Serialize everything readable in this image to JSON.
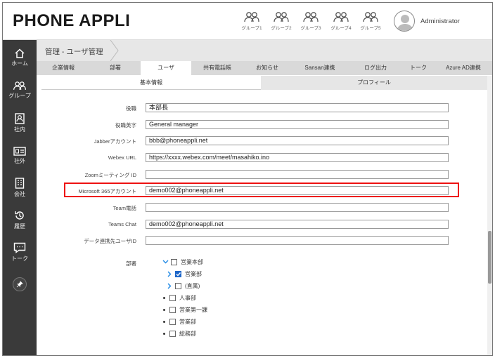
{
  "header": {
    "logo": "PHONE APPLI",
    "groups": [
      "グループ1",
      "グループ2",
      "グループ3",
      "グループ4",
      "グループ5"
    ],
    "user_name": "Administrator"
  },
  "sidebar": {
    "items": [
      {
        "label": "ホーム",
        "icon": "home-icon"
      },
      {
        "label": "グループ",
        "icon": "people-icon"
      },
      {
        "label": "社内",
        "icon": "contact-card-icon"
      },
      {
        "label": "社外",
        "icon": "id-card-icon"
      },
      {
        "label": "会社",
        "icon": "building-icon"
      },
      {
        "label": "履歴",
        "icon": "history-icon"
      },
      {
        "label": "トーク",
        "icon": "chat-icon"
      }
    ],
    "pin_icon": "pin-icon"
  },
  "breadcrumb": "管理 - ユーザ管理",
  "tabs": [
    "企業情報",
    "部署",
    "ユーザ",
    "共有電話帳",
    "お知らせ",
    "Sansan連携",
    "ログ出力",
    "トーク",
    "Azure AD連携"
  ],
  "active_tab": "ユーザ",
  "subtabs": [
    "基本情報",
    "プロフィール"
  ],
  "form": {
    "fields": [
      {
        "label": "役職",
        "value": "本部長"
      },
      {
        "label": "役職英字",
        "value": "General manager"
      },
      {
        "label": "Jabberアカウント",
        "value": "bbb@phoneappli.net"
      },
      {
        "label": "Webex URL",
        "value": "https://xxxx.webex.com/meet/masahiko.ino"
      },
      {
        "label": "Zoomミーティング ID",
        "value": ""
      },
      {
        "label": "Microsoft 365アカウント",
        "value": "demo002@phoneappli.net"
      },
      {
        "label": "Team電話",
        "value": ""
      },
      {
        "label": "Teams Chat",
        "value": "demo002@phoneappli.net"
      },
      {
        "label": "データ連携先ユーザID",
        "value": ""
      }
    ],
    "dept_label": "部署",
    "dept_tree": [
      {
        "label": "営業本部",
        "checked": false,
        "toggle": "expanded"
      },
      {
        "label": "営業部",
        "checked": true,
        "toggle": "collapsed"
      },
      {
        "label": "(直属)",
        "checked": false,
        "toggle": "collapsed"
      },
      {
        "label": "人事部",
        "checked": false,
        "toggle": "leaf"
      },
      {
        "label": "営業第一課",
        "checked": false,
        "toggle": "leaf"
      },
      {
        "label": "営業部",
        "checked": false,
        "toggle": "leaf"
      },
      {
        "label": "総務部",
        "checked": false,
        "toggle": "leaf"
      }
    ]
  },
  "colors": {
    "accent": "#1e66c8",
    "highlight": "#ee1111",
    "sidebar": "#3a3a3a"
  }
}
